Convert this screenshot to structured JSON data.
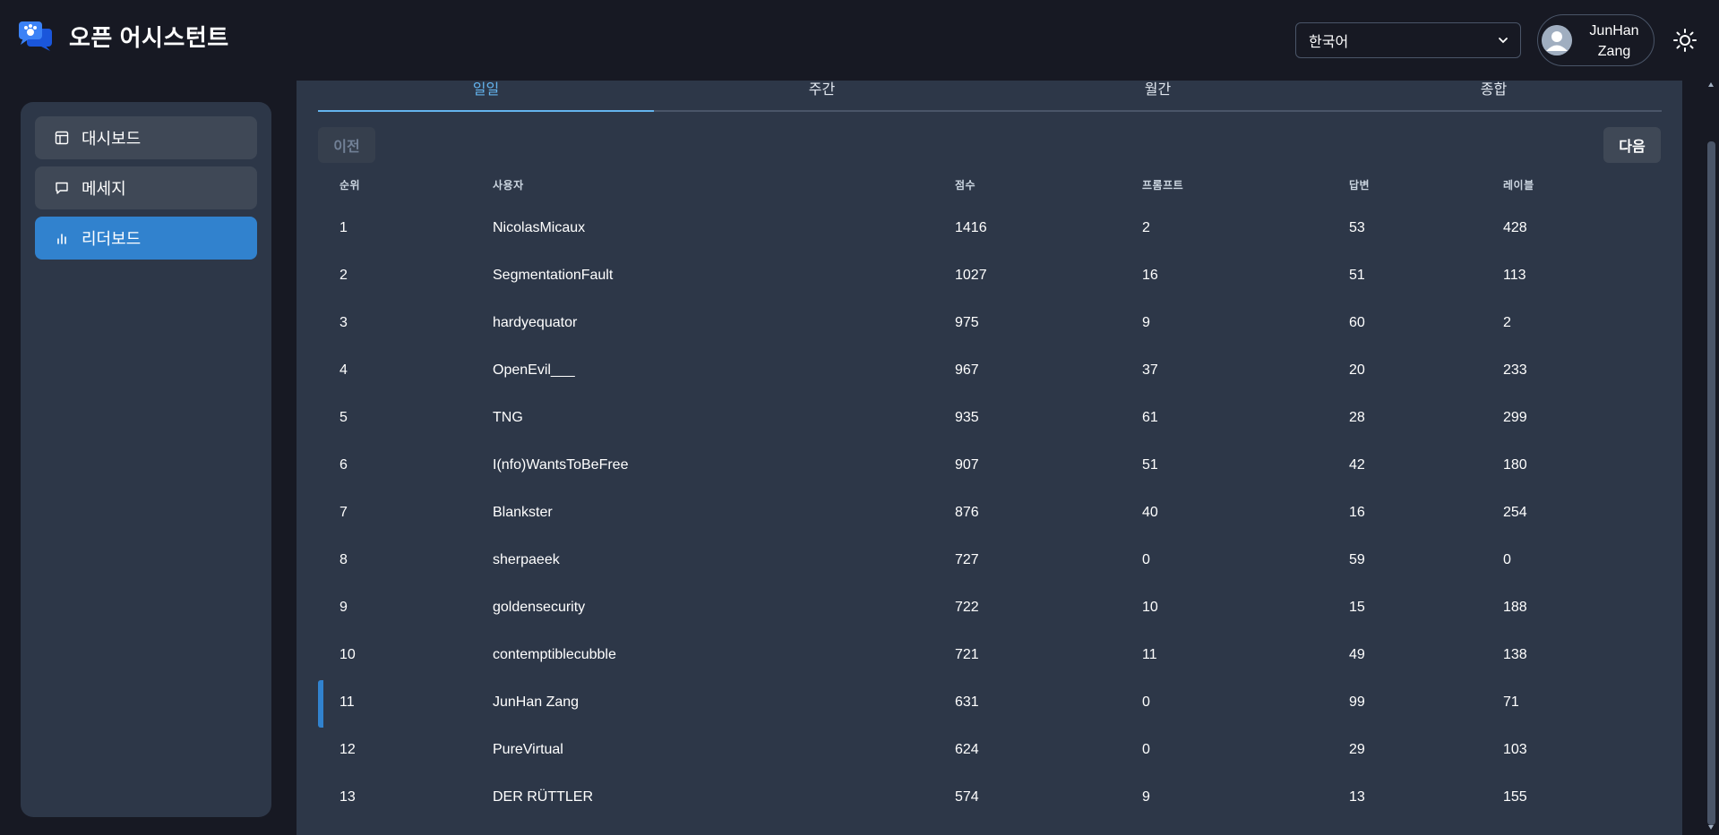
{
  "app": {
    "title": "오픈 어시스턴트"
  },
  "header": {
    "language": "한국어",
    "user_name": "JunHan Zang"
  },
  "sidebar": {
    "items": [
      {
        "label": "대시보드",
        "icon": "layout-icon",
        "active": false
      },
      {
        "label": "메세지",
        "icon": "message-icon",
        "active": false
      },
      {
        "label": "리더보드",
        "icon": "bar-chart-icon",
        "active": true
      }
    ]
  },
  "tabs": [
    {
      "label": "일일",
      "active": true
    },
    {
      "label": "주간",
      "active": false
    },
    {
      "label": "월간",
      "active": false
    },
    {
      "label": "종합",
      "active": false
    }
  ],
  "pagination": {
    "prev_label": "이전",
    "next_label": "다음"
  },
  "table": {
    "columns": [
      "순위",
      "사용자",
      "점수",
      "프롬프트",
      "답변",
      "레이블"
    ],
    "rows": [
      [
        "1",
        "NicolasMicaux",
        "1416",
        "2",
        "53",
        "428"
      ],
      [
        "2",
        "SegmentationFault",
        "1027",
        "16",
        "51",
        "113"
      ],
      [
        "3",
        "hardyequator",
        "975",
        "9",
        "60",
        "2"
      ],
      [
        "4",
        "OpenEvil___",
        "967",
        "37",
        "20",
        "233"
      ],
      [
        "5",
        "TNG",
        "935",
        "61",
        "28",
        "299"
      ],
      [
        "6",
        "I(nfo)WantsToBeFree",
        "907",
        "51",
        "42",
        "180"
      ],
      [
        "7",
        "Blankster",
        "876",
        "40",
        "16",
        "254"
      ],
      [
        "8",
        "sherpaeek",
        "727",
        "0",
        "59",
        "0"
      ],
      [
        "9",
        "goldensecurity",
        "722",
        "10",
        "15",
        "188"
      ],
      [
        "10",
        "contemptiblecubble",
        "721",
        "11",
        "49",
        "138"
      ],
      [
        "11",
        "JunHan Zang",
        "631",
        "0",
        "99",
        "71"
      ],
      [
        "12",
        "PureVirtual",
        "624",
        "0",
        "29",
        "103"
      ],
      [
        "13",
        "DER RÜTTLER",
        "574",
        "9",
        "13",
        "155"
      ]
    ],
    "highlighted_row": 10
  },
  "colors": {
    "background": "#171923",
    "panel": "#2d3748",
    "accent": "#3182ce",
    "active_tab": "#63b3ed"
  }
}
